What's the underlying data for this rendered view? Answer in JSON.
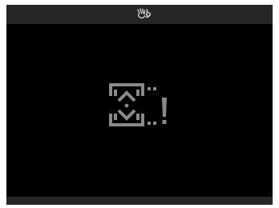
{
  "colors": {
    "background": "#000000",
    "bar": "#262626",
    "icon": "#8a8a8a",
    "status_icon": "#cfcfcf"
  },
  "icons": {
    "status": "hand-wave-gesture-icon",
    "warning": "scroll-up-down-warning-icon"
  }
}
